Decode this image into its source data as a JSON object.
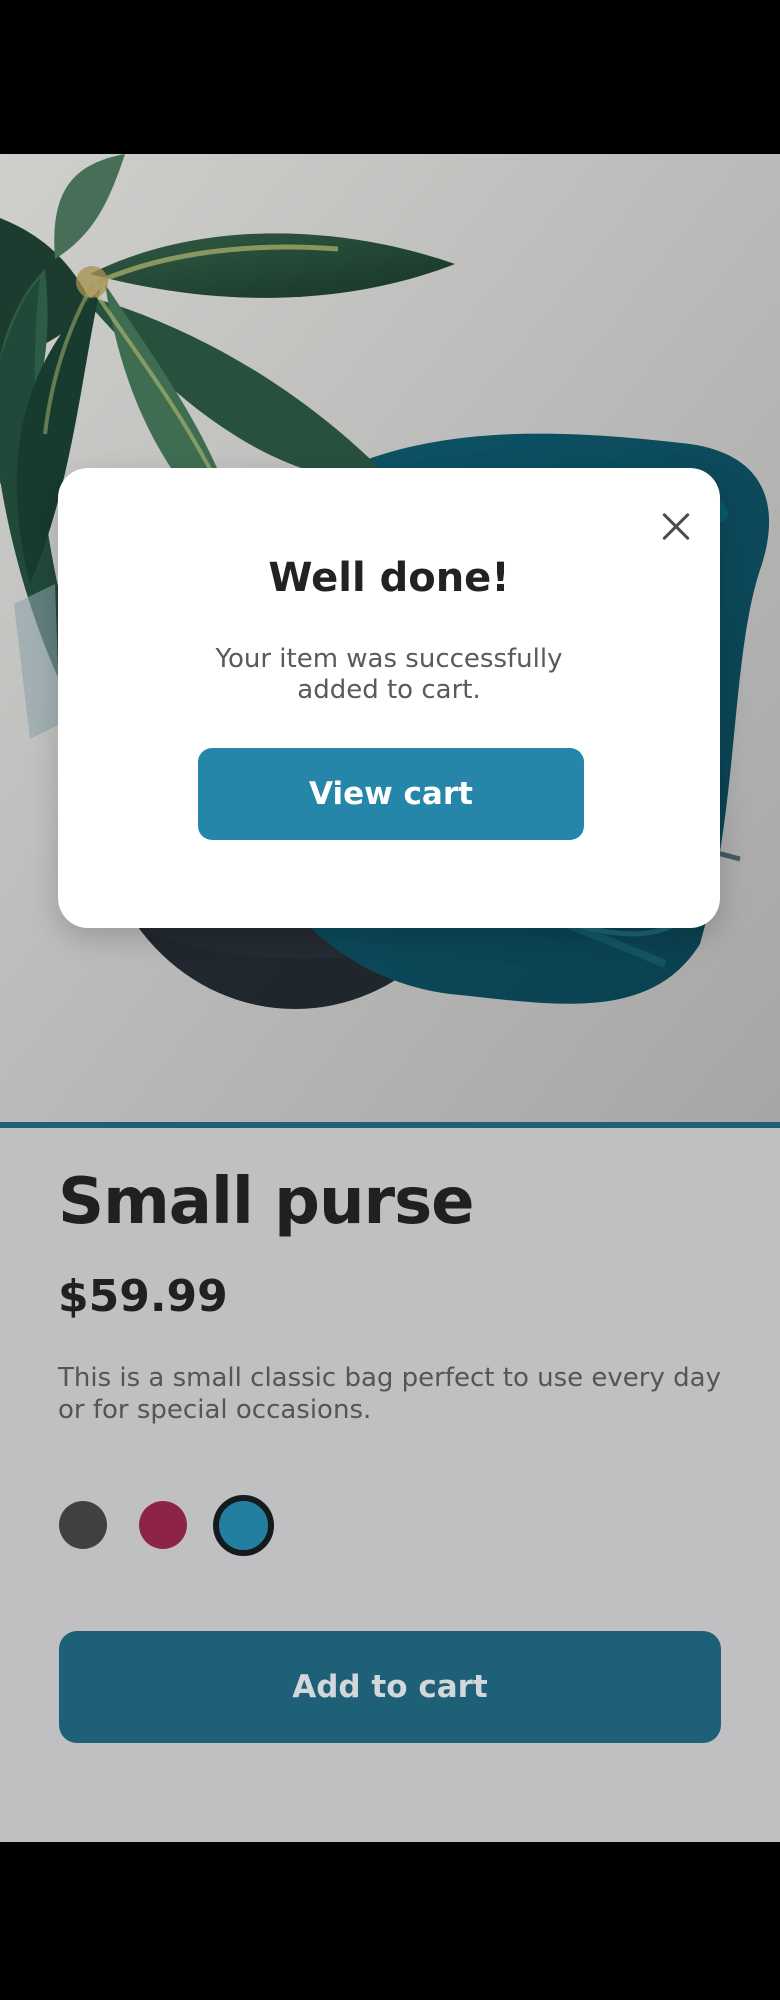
{
  "modal": {
    "title": "Well done!",
    "message": "Your item was successfully added to cart.",
    "button_label": "View cart",
    "close_icon": "close-icon"
  },
  "product": {
    "title": "Small purse",
    "price": "$59.99",
    "description": "This is a small classic bag perfect to use every day or for special occasions.",
    "add_to_cart_label": "Add to cart",
    "selected_color_index": 2,
    "colors": [
      {
        "hex": "#404040"
      },
      {
        "hex": "#8d2448"
      },
      {
        "hex": "#237f9f"
      }
    ]
  },
  "theme": {
    "accent": "#2686aa",
    "add_to_cart_background": "#1e6078",
    "panel_background": "#c0c0c2"
  }
}
